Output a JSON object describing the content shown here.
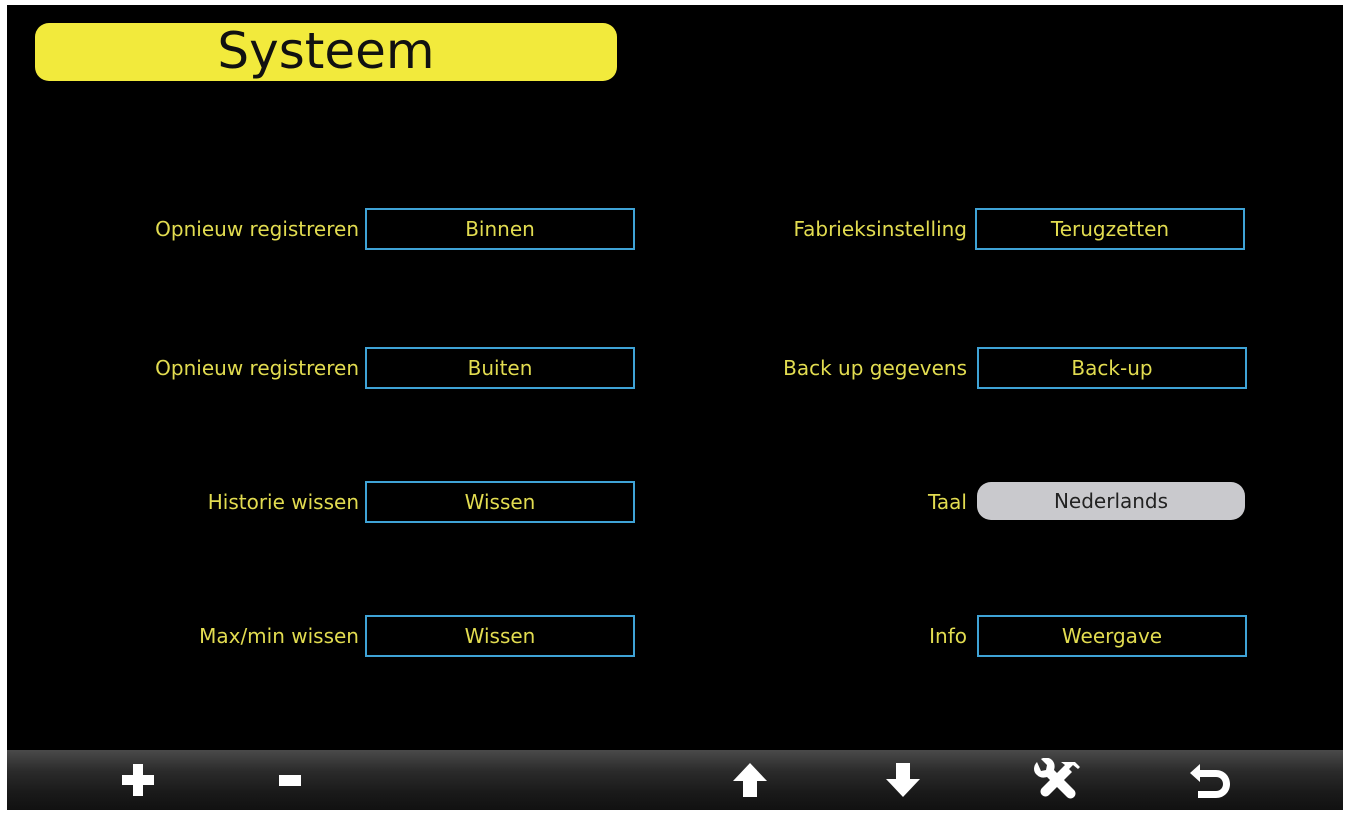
{
  "screen": {
    "title": "Systeem"
  },
  "left_rows": [
    {
      "label": "Opnieuw registreren",
      "button": "Binnen"
    },
    {
      "label": "Opnieuw registreren",
      "button": "Buiten"
    },
    {
      "label": "Historie wissen",
      "button": "Wissen"
    },
    {
      "label": "Max/min wissen",
      "button": "Wissen"
    }
  ],
  "right_rows": [
    {
      "label": "Fabrieksinstelling",
      "button": "Terugzetten"
    },
    {
      "label": "Back up gegevens",
      "button": "Back-up"
    },
    {
      "label": "Taal",
      "button": "Nederlands"
    },
    {
      "label": "Info",
      "button": "Weergave"
    }
  ],
  "bottom_bar": {
    "icons": [
      "plus-icon",
      "minus-icon",
      "arrow-up-icon",
      "arrow-down-icon",
      "tools-icon",
      "back-icon"
    ]
  },
  "colors": {
    "title_background": "#f2ea3c",
    "label_text": "#e2dc50",
    "button_border": "#3fa3d6",
    "selected_background": "#c9c9cd",
    "screen_background": "#000000"
  }
}
